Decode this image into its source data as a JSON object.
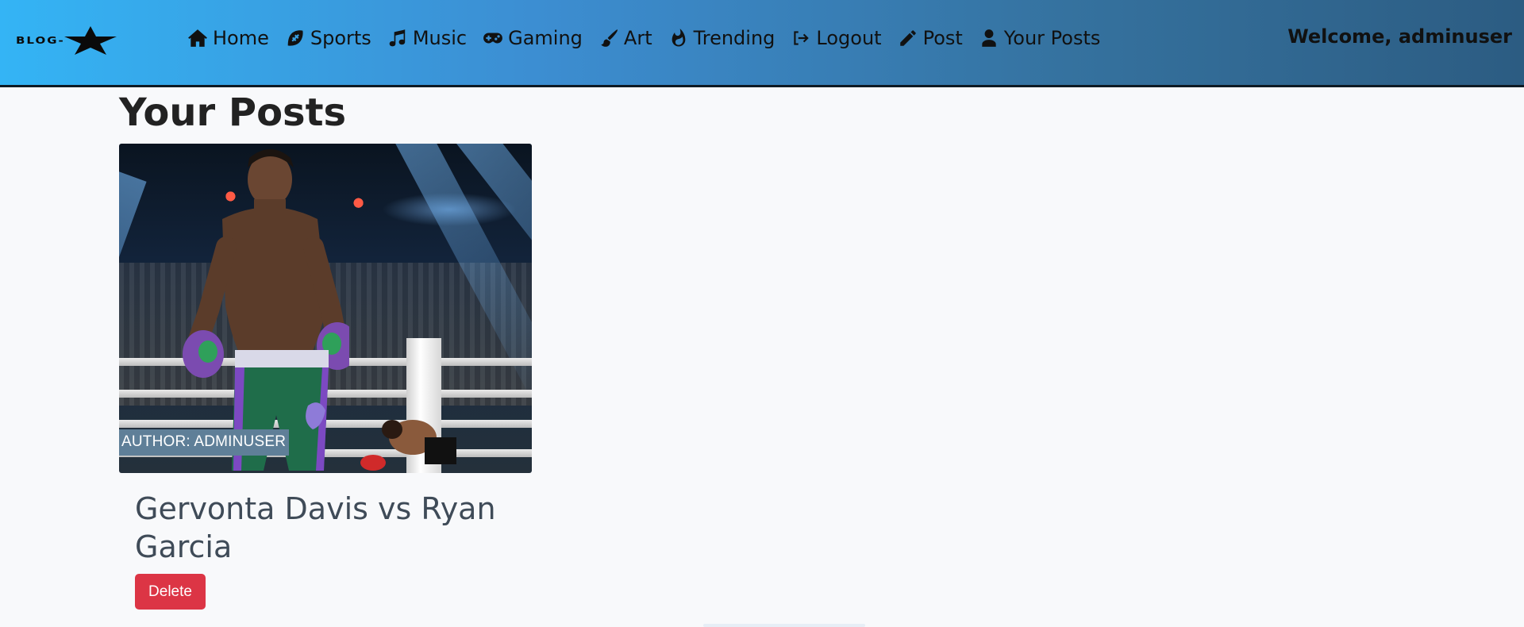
{
  "brand": {
    "text": "BLOG-"
  },
  "nav": {
    "items": [
      {
        "label": "Home",
        "icon": "home-icon"
      },
      {
        "label": "Sports",
        "icon": "football-icon"
      },
      {
        "label": "Music",
        "icon": "music-note-icon"
      },
      {
        "label": "Gaming",
        "icon": "gamepad-icon"
      },
      {
        "label": "Art",
        "icon": "paintbrush-icon"
      },
      {
        "label": "Trending",
        "icon": "flame-icon"
      },
      {
        "label": "Logout",
        "icon": "sign-out-icon"
      },
      {
        "label": "Post",
        "icon": "pencil-icon"
      },
      {
        "label": "Your Posts",
        "icon": "user-icon"
      }
    ],
    "welcome": "Welcome, adminuser"
  },
  "page": {
    "title": "Your Posts"
  },
  "posts": [
    {
      "author_label": "AUTHOR: ADMINUSER",
      "title": "Gervonta Davis vs Ryan Garcia",
      "delete_label": "Delete"
    }
  ],
  "colors": {
    "nav_gradient_start": "#34b4f5",
    "nav_gradient_end": "#2c5c82",
    "delete_button": "#dc3545",
    "author_tag": "#5f7f98"
  }
}
